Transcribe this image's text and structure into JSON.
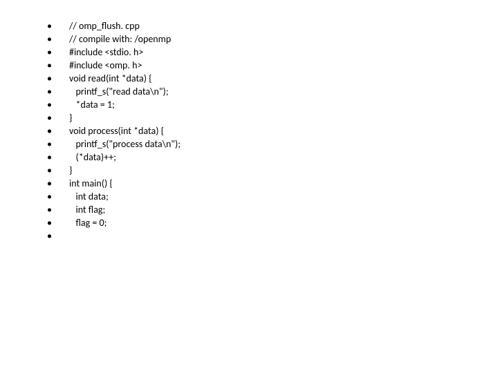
{
  "code_lines": [
    "// omp_flush. cpp",
    "// compile with: /openmp",
    "#include <stdio. h>",
    "#include <omp. h>",
    "",
    "void read(int *data) {",
    "   printf_s(\"read data\\n\");",
    "   *data = 1;",
    "}",
    "",
    "void process(int *data) {",
    "   printf_s(\"process data\\n\");",
    "   (*data)++;",
    "}",
    "",
    "int main() {",
    "   int data;",
    "   int flag;",
    "",
    "   flag = 0;",
    "",
    ""
  ]
}
